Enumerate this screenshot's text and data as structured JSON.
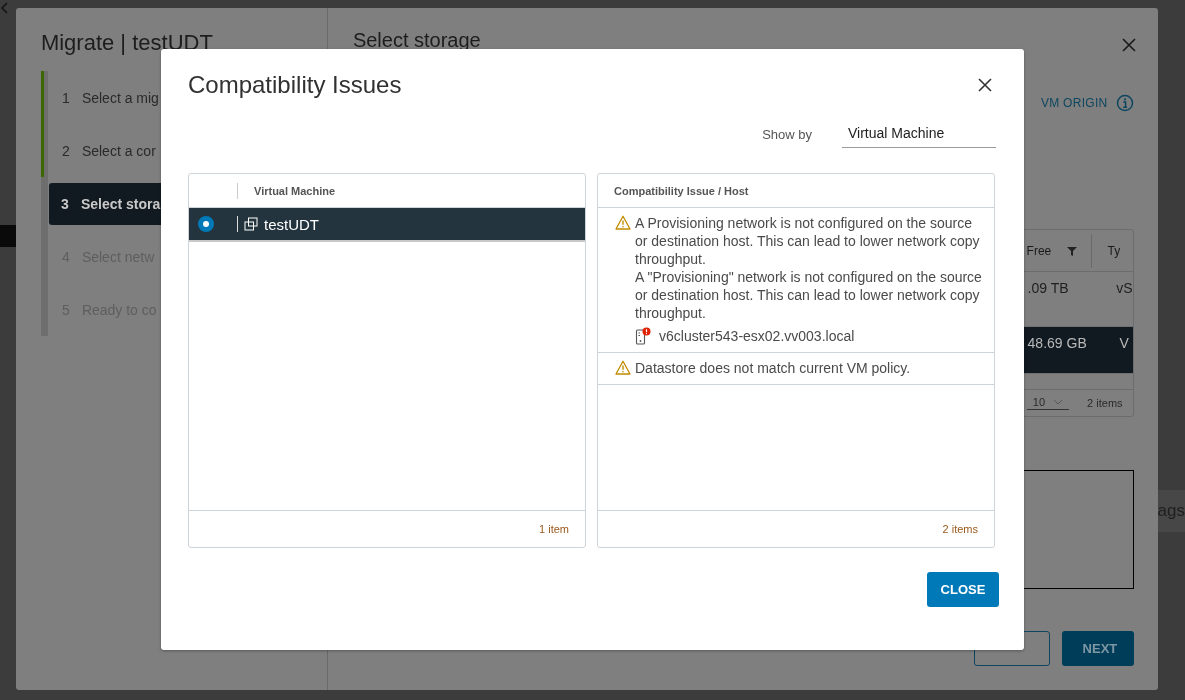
{
  "wizard": {
    "title": "Migrate | testUDT",
    "steps": [
      {
        "number": "1",
        "label": "Select a mig",
        "completed": true,
        "selected": false
      },
      {
        "number": "2",
        "label": "Select a cor",
        "completed": true,
        "selected": false
      },
      {
        "number": "3",
        "label": "Select stora",
        "completed": false,
        "selected": true
      },
      {
        "number": "4",
        "label": "Select netw",
        "completed": false,
        "selected": false
      },
      {
        "number": "5",
        "label": "Ready to co",
        "completed": false,
        "selected": false
      }
    ],
    "page_title": "Select storage",
    "vm_origin": "VM ORIGIN",
    "table": {
      "columns": [
        "Free",
        "Ty"
      ],
      "rows": [
        {
          "cells": [
            ".09 TB",
            "vS"
          ],
          "selected": false
        },
        {
          "cells": [
            "48.69 GB",
            "V"
          ],
          "selected": true
        }
      ],
      "page_size": "10",
      "count": "2 items"
    },
    "side_text": "ags",
    "buttons": [
      {
        "kind": "outline"
      },
      {
        "label": "NEXT",
        "kind": "primary"
      }
    ]
  },
  "dialog": {
    "title": "Compatibility Issues",
    "show_by": {
      "label": "Show by",
      "value": "Virtual Machine"
    },
    "vm_table": {
      "column": "Virtual Machine",
      "rows": [
        {
          "name": "testUDT",
          "selected": true
        }
      ],
      "footer": "1 item"
    },
    "issue_table": {
      "column": "Compatibility Issue / Host",
      "rows": [
        {
          "messages": [
            "A Provisioning network is not configured on the source or destination host. This can lead to lower network copy throughput.",
            "A \"Provisioning\" network is not configured on the source or destination host. This can lead to lower network copy throughput."
          ],
          "host": "v6cluster543-esx02.vv003.local"
        },
        {
          "messages": [
            "Datastore does not match current VM policy."
          ]
        }
      ],
      "footer": "2 items"
    },
    "buttons": [
      {
        "label": "CLOSE",
        "kind": "primary"
      }
    ]
  }
}
